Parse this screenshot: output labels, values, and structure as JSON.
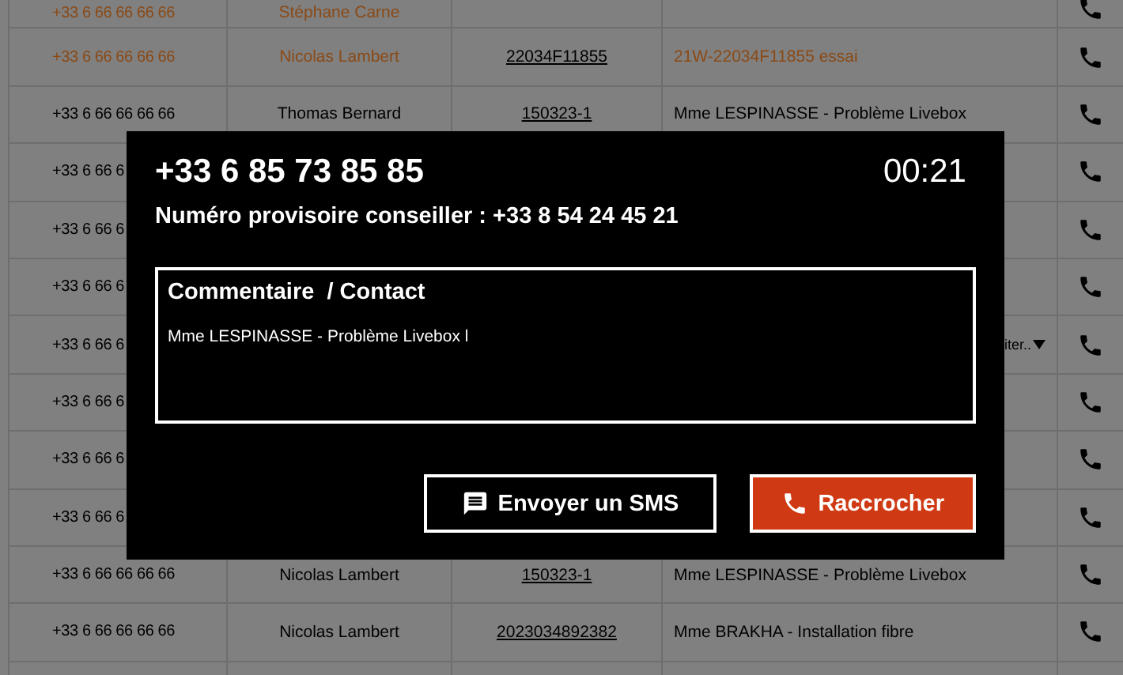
{
  "table": {
    "rows": [
      {
        "highlighted": true,
        "phone": "+33 6 66 66 66 66",
        "name": "Stéphane Carne",
        "reference": "",
        "comment": ""
      },
      {
        "highlighted": true,
        "phone": "+33 6 66 66 66 66",
        "name": "Nicolas Lambert",
        "reference": "22034F11855",
        "comment": "21W-22034F11855 essai"
      },
      {
        "highlighted": false,
        "phone": "+33 6 66 66 66 66",
        "name": "Thomas Bernard",
        "reference": "150323-1",
        "comment": "Mme LESPINASSE - Problème Livebox"
      },
      {
        "highlighted": false,
        "phone": "+33 6 66 6",
        "name": "",
        "reference": "",
        "comment": ""
      },
      {
        "highlighted": false,
        "phone": "+33 6 66 6",
        "name": "",
        "reference": "",
        "comment": ""
      },
      {
        "highlighted": false,
        "phone": "+33 6 66 6",
        "name": "",
        "reference": "",
        "comment": ""
      },
      {
        "highlighted": false,
        "phone": "+33 6 66 6",
        "name": "",
        "reference": "",
        "comment": "",
        "status": "iter.."
      },
      {
        "highlighted": false,
        "phone": "+33 6 66 6",
        "name": "",
        "reference": "",
        "comment": ""
      },
      {
        "highlighted": false,
        "phone": "+33 6 66 6",
        "name": "",
        "reference": "",
        "comment": ""
      },
      {
        "highlighted": false,
        "phone": "+33 6 66 6",
        "name": "",
        "reference": "",
        "comment": ""
      },
      {
        "highlighted": false,
        "phone": "+33 6 66 66 66 66",
        "name": "Nicolas Lambert",
        "reference": "150323-1",
        "comment": "Mme LESPINASSE - Problème Livebox"
      },
      {
        "highlighted": false,
        "phone": "+33 6 66 66 66 66",
        "name": "Nicolas Lambert",
        "reference": "2023034892382",
        "comment": "Mme BRAKHA - Installation fibre"
      },
      {
        "phone": "",
        "name": "",
        "reference": "",
        "comment": ""
      }
    ]
  },
  "call_dialog": {
    "number": "+33 6 85 73 85 85",
    "timer": "00:21",
    "advisor_number": "Numéro provisoire conseiller : +33 8 54 24 45 21",
    "comment": {
      "label": "Commentaire  / Contact",
      "value": "Mme LESPINASSE - Problème Livebox l"
    },
    "buttons": [
      {
        "kind": "sms",
        "label": "Envoyer un SMS"
      },
      {
        "kind": "hangup",
        "label": "Raccrocher"
      }
    ]
  }
}
